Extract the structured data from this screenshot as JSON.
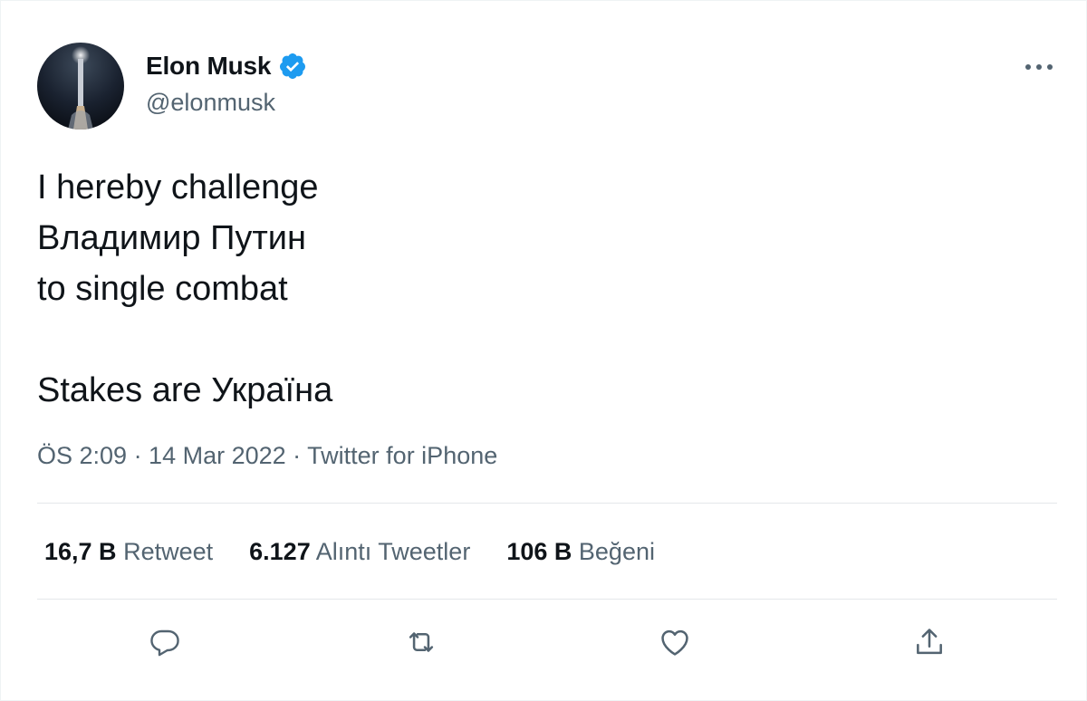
{
  "author": {
    "display_name": "Elon Musk",
    "handle": "@elonmusk",
    "verified": true
  },
  "tweet": {
    "lines": [
      "I hereby challenge",
      "Владимир Путин",
      "to single combat"
    ],
    "final_line": "Stakes are Україна"
  },
  "meta": {
    "text": "ÖS 2:09 · 14 Mar 2022 · Twitter for iPhone"
  },
  "stats": {
    "retweets": {
      "value": "16,7 B",
      "label": "Retweet"
    },
    "quotes": {
      "value": "6.127",
      "label": "Alıntı Tweetler"
    },
    "likes": {
      "value": "106 B",
      "label": "Beğeni"
    }
  },
  "icons": {
    "verified": "verified-badge-icon",
    "more": "more-icon",
    "reply": "reply-icon",
    "retweet": "retweet-icon",
    "like": "like-icon",
    "share": "share-icon"
  },
  "colors": {
    "verified_blue": "#1d9bf0",
    "text_primary": "#0f1419",
    "text_secondary": "#536471",
    "divider": "#e4e8ea"
  }
}
